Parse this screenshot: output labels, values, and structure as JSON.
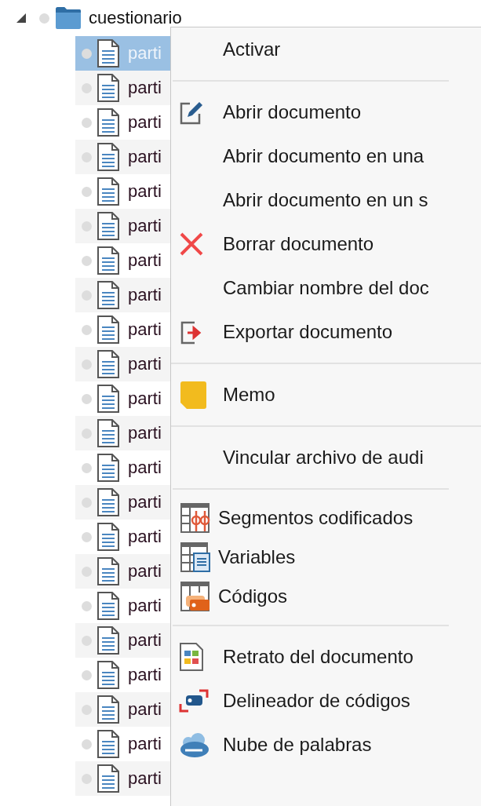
{
  "tree": {
    "label": "cuestionario",
    "expanded": true,
    "children": [
      {
        "label": "parti",
        "selected": true
      },
      {
        "label": "parti",
        "selected": false
      },
      {
        "label": "parti",
        "selected": false
      },
      {
        "label": "parti",
        "selected": false
      },
      {
        "label": "parti",
        "selected": false
      },
      {
        "label": "parti",
        "selected": false
      },
      {
        "label": "parti",
        "selected": false
      },
      {
        "label": "parti",
        "selected": false
      },
      {
        "label": "parti",
        "selected": false
      },
      {
        "label": "parti",
        "selected": false
      },
      {
        "label": "parti",
        "selected": false
      },
      {
        "label": "parti",
        "selected": false
      },
      {
        "label": "parti",
        "selected": false
      },
      {
        "label": "parti",
        "selected": false
      },
      {
        "label": "parti",
        "selected": false
      },
      {
        "label": "parti",
        "selected": false
      },
      {
        "label": "parti",
        "selected": false
      },
      {
        "label": "parti",
        "selected": false
      },
      {
        "label": "parti",
        "selected": false
      },
      {
        "label": "parti",
        "selected": false
      },
      {
        "label": "parti",
        "selected": false
      },
      {
        "label": "parti",
        "selected": false
      }
    ]
  },
  "context_menu": {
    "items": [
      {
        "kind": "plain",
        "label": "Activar"
      },
      {
        "kind": "shortrule"
      },
      {
        "kind": "edit",
        "label": "Abrir documento"
      },
      {
        "kind": "plain",
        "label": "Abrir documento en una"
      },
      {
        "kind": "plain",
        "label": "Abrir documento en un s"
      },
      {
        "kind": "delete",
        "label": "Borrar documento"
      },
      {
        "kind": "plain",
        "label": "Cambiar nombre del doc"
      },
      {
        "kind": "export",
        "label": "Exportar documento"
      },
      {
        "kind": "fullrule"
      },
      {
        "kind": "memo",
        "label": "Memo"
      },
      {
        "kind": "fullrule"
      },
      {
        "kind": "plain",
        "label": "Vincular archivo de audi"
      },
      {
        "kind": "shortrule"
      },
      {
        "kind": "segments",
        "label": "Segmentos codificados"
      },
      {
        "kind": "variables",
        "label": "Variables"
      },
      {
        "kind": "codes",
        "label": "Códigos"
      },
      {
        "kind": "shortrule"
      },
      {
        "kind": "portrait",
        "label": "Retrato del documento"
      },
      {
        "kind": "mapper",
        "label": "Delineador de códigos"
      },
      {
        "kind": "cloud",
        "label": "Nube de palabras"
      }
    ]
  }
}
